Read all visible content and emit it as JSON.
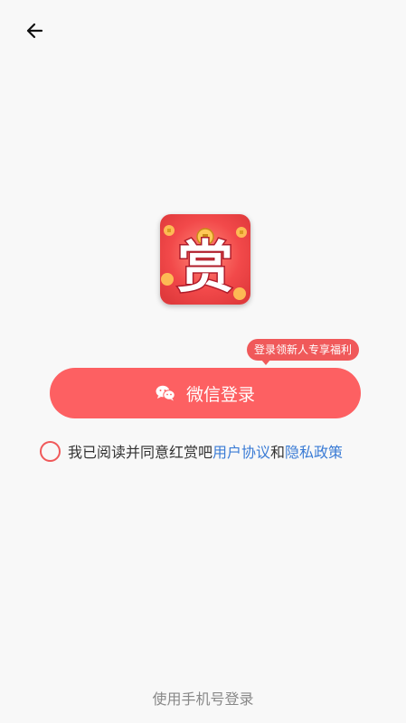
{
  "header": {
    "back_icon": "arrow-left-icon"
  },
  "logo": {
    "glyph": "赏",
    "icon": "app-logo-icon"
  },
  "promo": {
    "badge_text": "登录领新人专享福利"
  },
  "wechat_login": {
    "label": "微信登录",
    "icon": "wechat-icon"
  },
  "agreement": {
    "prefix": "我已阅读并同意红赏吧",
    "user_agreement": "用户协议",
    "conjunction": "和",
    "privacy_policy": "隐私政策"
  },
  "footer": {
    "phone_login": "使用手机号登录"
  },
  "colors": {
    "accent": "#fd6062",
    "link": "#3a7bd5",
    "background": "#f8f8f8"
  }
}
